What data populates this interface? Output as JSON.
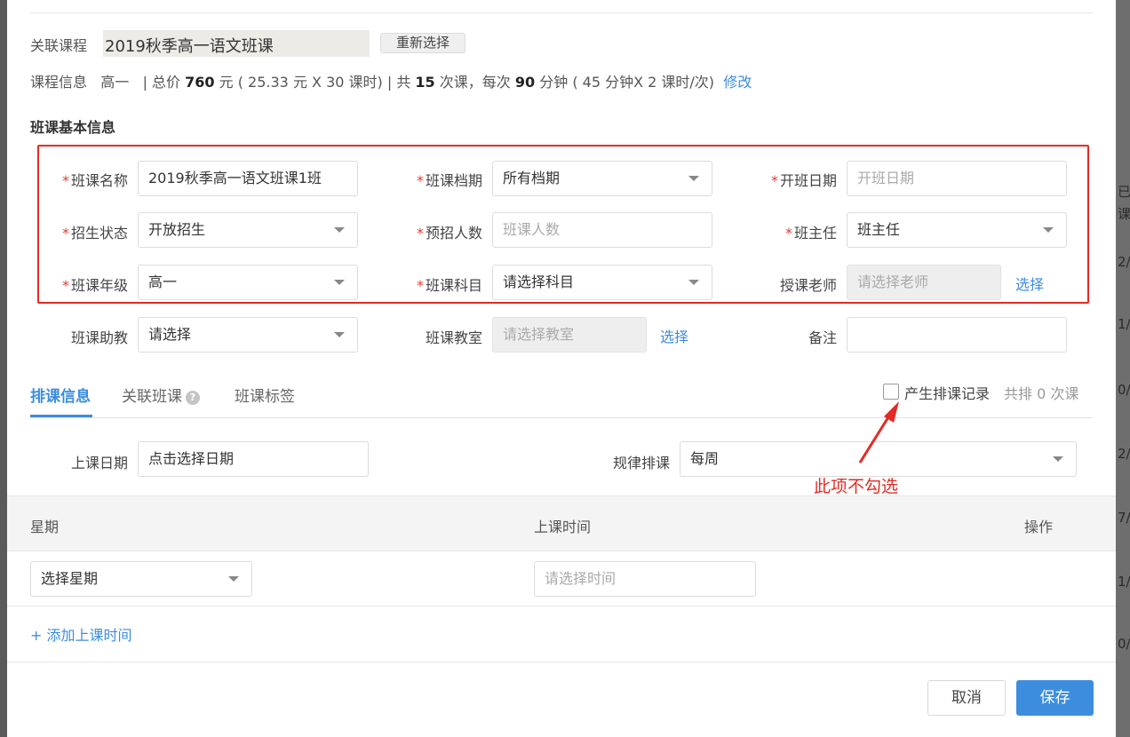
{
  "background": {
    "right_fragments": [
      "已",
      "课",
      "2/",
      "1/",
      "0/",
      "2/",
      "7/",
      "1/",
      "0/"
    ]
  },
  "linked_course": {
    "label": "关联课程",
    "value": "2019秋季高一语文班课",
    "reselect_label": "重新选择"
  },
  "course_info": {
    "label": "课程信息",
    "grade": "高一",
    "segments": [
      {
        "text": "| 总价 ",
        "bold": false
      },
      {
        "text": "760",
        "bold": true
      },
      {
        "text": " 元 ( 25.33 元 X 30 课时) | 共 ",
        "bold": false
      },
      {
        "text": "15",
        "bold": true
      },
      {
        "text": " 次课，每次 ",
        "bold": false
      },
      {
        "text": "90",
        "bold": true
      },
      {
        "text": " 分钟 ( 45 分钟X 2 课时/次)",
        "bold": false
      }
    ],
    "edit_label": "修改"
  },
  "basic_info": {
    "title": "班课基本信息",
    "class_name": {
      "label": "班课名称",
      "value": "2019秋季高一语文班课1班"
    },
    "term": {
      "label": "班课档期",
      "value": "所有档期"
    },
    "start_date": {
      "label": "开班日期",
      "placeholder": "开班日期"
    },
    "enroll_status": {
      "label": "招生状态",
      "value": "开放招生"
    },
    "planned_count": {
      "label": "预招人数",
      "placeholder": "班课人数"
    },
    "head_teacher": {
      "label": "班主任",
      "value": "班主任"
    },
    "grade": {
      "label": "班课年级",
      "value": "高一"
    },
    "subject": {
      "label": "班课科目",
      "value": "请选择科目"
    },
    "teacher": {
      "label": "授课老师",
      "placeholder": "请选择老师",
      "select_label": "选择"
    },
    "assistant": {
      "label": "班课助教",
      "value": "请选择"
    },
    "classroom": {
      "label": "班课教室",
      "placeholder": "请选择教室",
      "select_label": "选择"
    },
    "remark": {
      "label": "备注",
      "value": ""
    }
  },
  "tabs": [
    {
      "label": "排课信息",
      "active": true
    },
    {
      "label": "关联班课",
      "active": false
    },
    {
      "label": "班课标签",
      "active": false
    }
  ],
  "schedule_record": {
    "checkbox_label": "产生排课记录",
    "checked": false,
    "count_text": "共排 0 次课"
  },
  "annotation": {
    "text": "此项不勾选",
    "color": "#e52a24"
  },
  "schedule": {
    "date_label": "上课日期",
    "date_value": "点击选择日期",
    "rule_label": "规律排课",
    "rule_value": "每周",
    "table": {
      "columns": [
        "星期",
        "上课时间",
        "操作"
      ],
      "row": {
        "weekday": "选择星期",
        "time_placeholder": "请选择时间"
      }
    },
    "add_time_label": "+ 添加上课时间"
  },
  "footer": {
    "cancel_label": "取消",
    "save_label": "保存"
  },
  "colors": {
    "accent": "#3c8dde",
    "required": "#e23b32",
    "highlight_box": "#e52a24"
  }
}
